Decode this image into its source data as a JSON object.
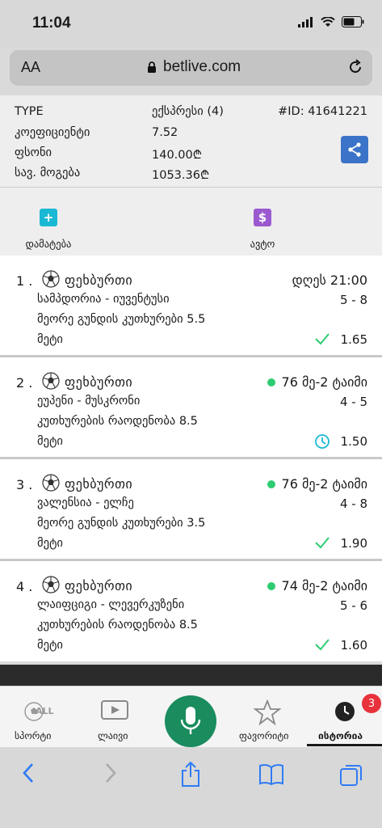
{
  "status_bar": {
    "time": "11:04"
  },
  "browser": {
    "text_size_label": "AA",
    "url": "betlive.com"
  },
  "ticket": {
    "type_label": "TYPE",
    "type_value": "ექსპრესი (4)",
    "id_label": "#ID: 41641221",
    "coef_label": "კოეფიციენტი",
    "coef_value": "7.52",
    "stake_label": "ფსონი",
    "stake_value": "140.00₾",
    "win_label": "სავ. მოგება",
    "win_value": "1053.36₾"
  },
  "actions": {
    "add_label": "დამატება",
    "auto_label": "ავტო",
    "add_color": "#1bb8d4",
    "auto_color": "#9b59d0"
  },
  "events": [
    {
      "num": "1 .",
      "sport": "ფეხბურთი",
      "status": "დღეს 21:00",
      "live": false,
      "teams": "სამპდორია - იუვენტუსი",
      "score": "5 - 8",
      "market": "მეორე გუნდის კუთხურები 5.5",
      "pick": "მეტი",
      "odd": "1.65",
      "result": "won"
    },
    {
      "num": "2 .",
      "sport": "ფეხბურთი",
      "status": "76 მე-2 ტაიმი",
      "live": true,
      "teams": "ეუპენი - მუსკრონი",
      "score": "4 - 5",
      "market": "კუთხურების რაოდენობა 8.5",
      "pick": "მეტი",
      "odd": "1.50",
      "result": "pending"
    },
    {
      "num": "3 .",
      "sport": "ფეხბურთი",
      "status": "76 მე-2 ტაიმი",
      "live": true,
      "teams": "ვალენსია - ელჩე",
      "score": "4 - 8",
      "market": "მეორე გუნდის კუთხურები 3.5",
      "pick": "მეტი",
      "odd": "1.90",
      "result": "won"
    },
    {
      "num": "4 .",
      "sport": "ფეხბურთი",
      "status": "74 მე-2 ტაიმი",
      "live": true,
      "teams": "ლაიფციგი - ლევერკუზენი",
      "score": "5 - 6",
      "market": "კუთხურების რაოდენობა 8.5",
      "pick": "მეტი",
      "odd": "1.60",
      "result": "won"
    }
  ],
  "tabs": {
    "sports": "სპორტი",
    "sports_icon_text": "ALL",
    "live": "ლაივი",
    "favorites": "ფავორიტი",
    "history": "ისტორია",
    "history_badge": "3"
  },
  "colors": {
    "accent_green": "#1a8c5e",
    "live_dot": "#2ecc71",
    "share_blue": "#3b73c8",
    "badge_red": "#e8323c"
  }
}
